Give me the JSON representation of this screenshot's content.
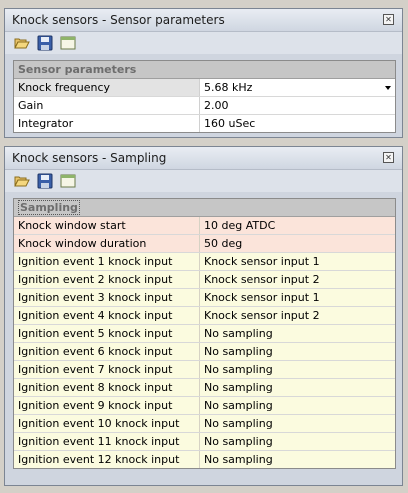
{
  "sensor_panel": {
    "title": "Knock sensors - Sensor parameters",
    "close_icon": "close-icon",
    "toolbar": [
      "open-folder-icon",
      "save-icon",
      "window-icon"
    ],
    "section": "Sensor parameters",
    "rows": [
      {
        "name": "Knock frequency",
        "value": "5.68 kHz"
      },
      {
        "name": "Gain",
        "value": "2.00"
      },
      {
        "name": "Integrator",
        "value": "160 uSec"
      }
    ]
  },
  "sampling_panel": {
    "title": "Knock sensors - Sampling",
    "close_icon": "close-icon",
    "toolbar": [
      "open-folder-icon",
      "save-icon",
      "window-icon"
    ],
    "section": "Sampling",
    "rows": [
      {
        "name": "Knock window start",
        "value": "10 deg ATDC"
      },
      {
        "name": "Knock window duration",
        "value": "50 deg"
      },
      {
        "name": "Ignition event 1 knock input",
        "value": "Knock sensor input 1"
      },
      {
        "name": "Ignition event 2 knock input",
        "value": "Knock sensor input 2"
      },
      {
        "name": "Ignition event 3 knock input",
        "value": "Knock sensor input 1"
      },
      {
        "name": "Ignition event 4 knock input",
        "value": "Knock sensor input 2"
      },
      {
        "name": "Ignition event 5 knock input",
        "value": "No sampling"
      },
      {
        "name": "Ignition event 6 knock input",
        "value": "No sampling"
      },
      {
        "name": "Ignition event 7 knock input",
        "value": "No sampling"
      },
      {
        "name": "Ignition event 8 knock input",
        "value": "No sampling"
      },
      {
        "name": "Ignition event 9 knock input",
        "value": "No sampling"
      },
      {
        "name": "Ignition event 10 knock input",
        "value": "No sampling"
      },
      {
        "name": "Ignition event 11 knock input",
        "value": "No sampling"
      },
      {
        "name": "Ignition event 12 knock input",
        "value": "No sampling"
      }
    ]
  },
  "colors": {
    "panel_bg": "#cfd5df",
    "section_header_bg": "#c6c6c6",
    "window_row_bg": "#fbe4da",
    "event_row_bg": "#fbfbdf"
  }
}
